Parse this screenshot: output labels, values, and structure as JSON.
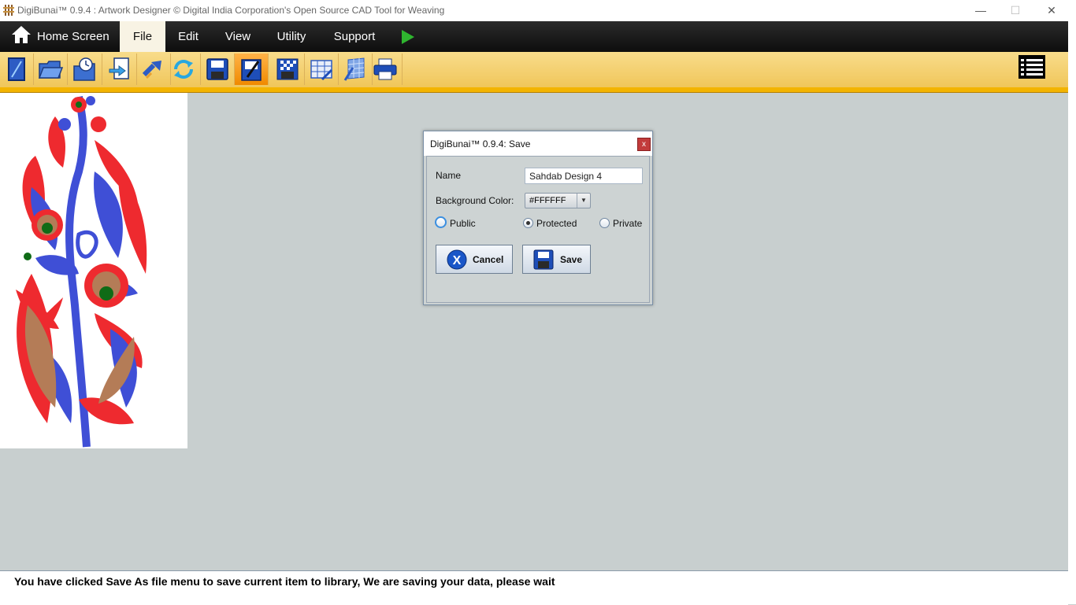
{
  "window": {
    "title": "DigiBunai™ 0.9.4 : Artwork Designer © Digital India Corporation's Open Source CAD Tool for Weaving",
    "minimize": "—",
    "maximize": "☐",
    "close": "✕"
  },
  "menubar": {
    "home_label": "Home Screen",
    "items": [
      {
        "label": "File",
        "active": true
      },
      {
        "label": "Edit"
      },
      {
        "label": "View"
      },
      {
        "label": "Utility"
      },
      {
        "label": "Support"
      }
    ],
    "run_icon": "play-icon"
  },
  "toolbar": {
    "buttons": [
      {
        "icon": "new-file-icon"
      },
      {
        "icon": "open-folder-icon"
      },
      {
        "icon": "recent-folder-icon"
      },
      {
        "icon": "import-icon"
      },
      {
        "icon": "export-icon"
      },
      {
        "icon": "refresh-icon"
      },
      {
        "icon": "save-icon"
      },
      {
        "icon": "save-as-icon",
        "active": true
      },
      {
        "icon": "save-texture-icon"
      },
      {
        "icon": "save-grid-icon"
      },
      {
        "icon": "edit-pattern-icon"
      },
      {
        "icon": "print-icon"
      }
    ],
    "menu_icon": "list-menu-icon"
  },
  "dialog": {
    "title": "DigiBunai™ 0.9.4: Save",
    "close_label": "x",
    "name_label": "Name",
    "name_value": "Sahdab Design 4",
    "bg_color_label": "Background Color:",
    "bg_color_value": "#FFFFFF",
    "visibility": {
      "public": "Public",
      "protected": "Protected",
      "private": "Private",
      "selected": "protected"
    },
    "cancel_label": "Cancel",
    "save_label": "Save"
  },
  "status": {
    "message": "You have clicked Save As file menu to save current item to library, We are saving your data, please wait"
  },
  "colors": {
    "menubar": "#1a1a1a",
    "toolbar": "#f4d16f",
    "accent_stripe": "#f3b400",
    "motif_red": "#ee2a2f",
    "motif_blue": "#3f4fd6",
    "motif_brown": "#b47c57",
    "motif_green": "#0f6b16"
  }
}
